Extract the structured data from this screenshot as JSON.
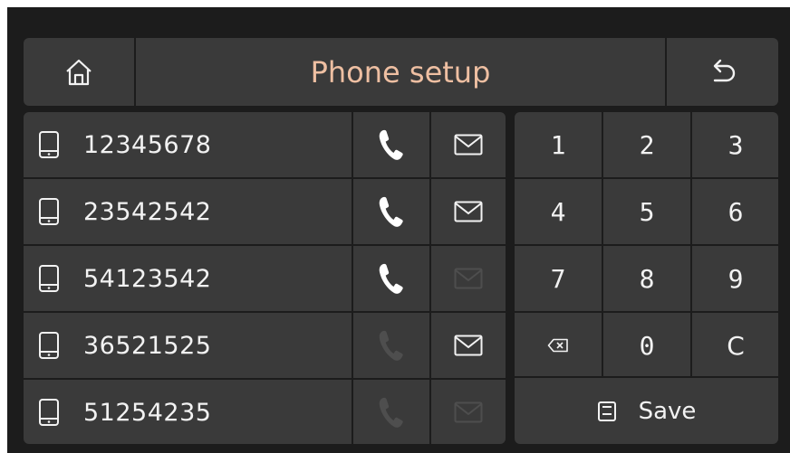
{
  "header": {
    "title": "Phone setup",
    "home_icon": "home-icon",
    "back_icon": "back-arrow-icon",
    "title_color": "#eebfa2"
  },
  "contacts": [
    {
      "number": "12345678",
      "call_enabled": true,
      "message_enabled": true
    },
    {
      "number": "23542542",
      "call_enabled": true,
      "message_enabled": true
    },
    {
      "number": "54123542",
      "call_enabled": true,
      "message_enabled": false
    },
    {
      "number": "36521525",
      "call_enabled": false,
      "message_enabled": true
    },
    {
      "number": "51254235",
      "call_enabled": false,
      "message_enabled": false
    }
  ],
  "keypad": {
    "keys": [
      "1",
      "2",
      "3",
      "4",
      "5",
      "6",
      "7",
      "8",
      "9",
      "",
      "0",
      "C"
    ],
    "backspace_icon": "backspace-icon",
    "save_label": "Save",
    "save_icon": "floppy-disk-icon"
  },
  "colors": {
    "background": "#1c1c1c",
    "panel": "#3a3a3a",
    "text": "#f2f2f2",
    "disabled_icon": "#4e4e4e"
  }
}
